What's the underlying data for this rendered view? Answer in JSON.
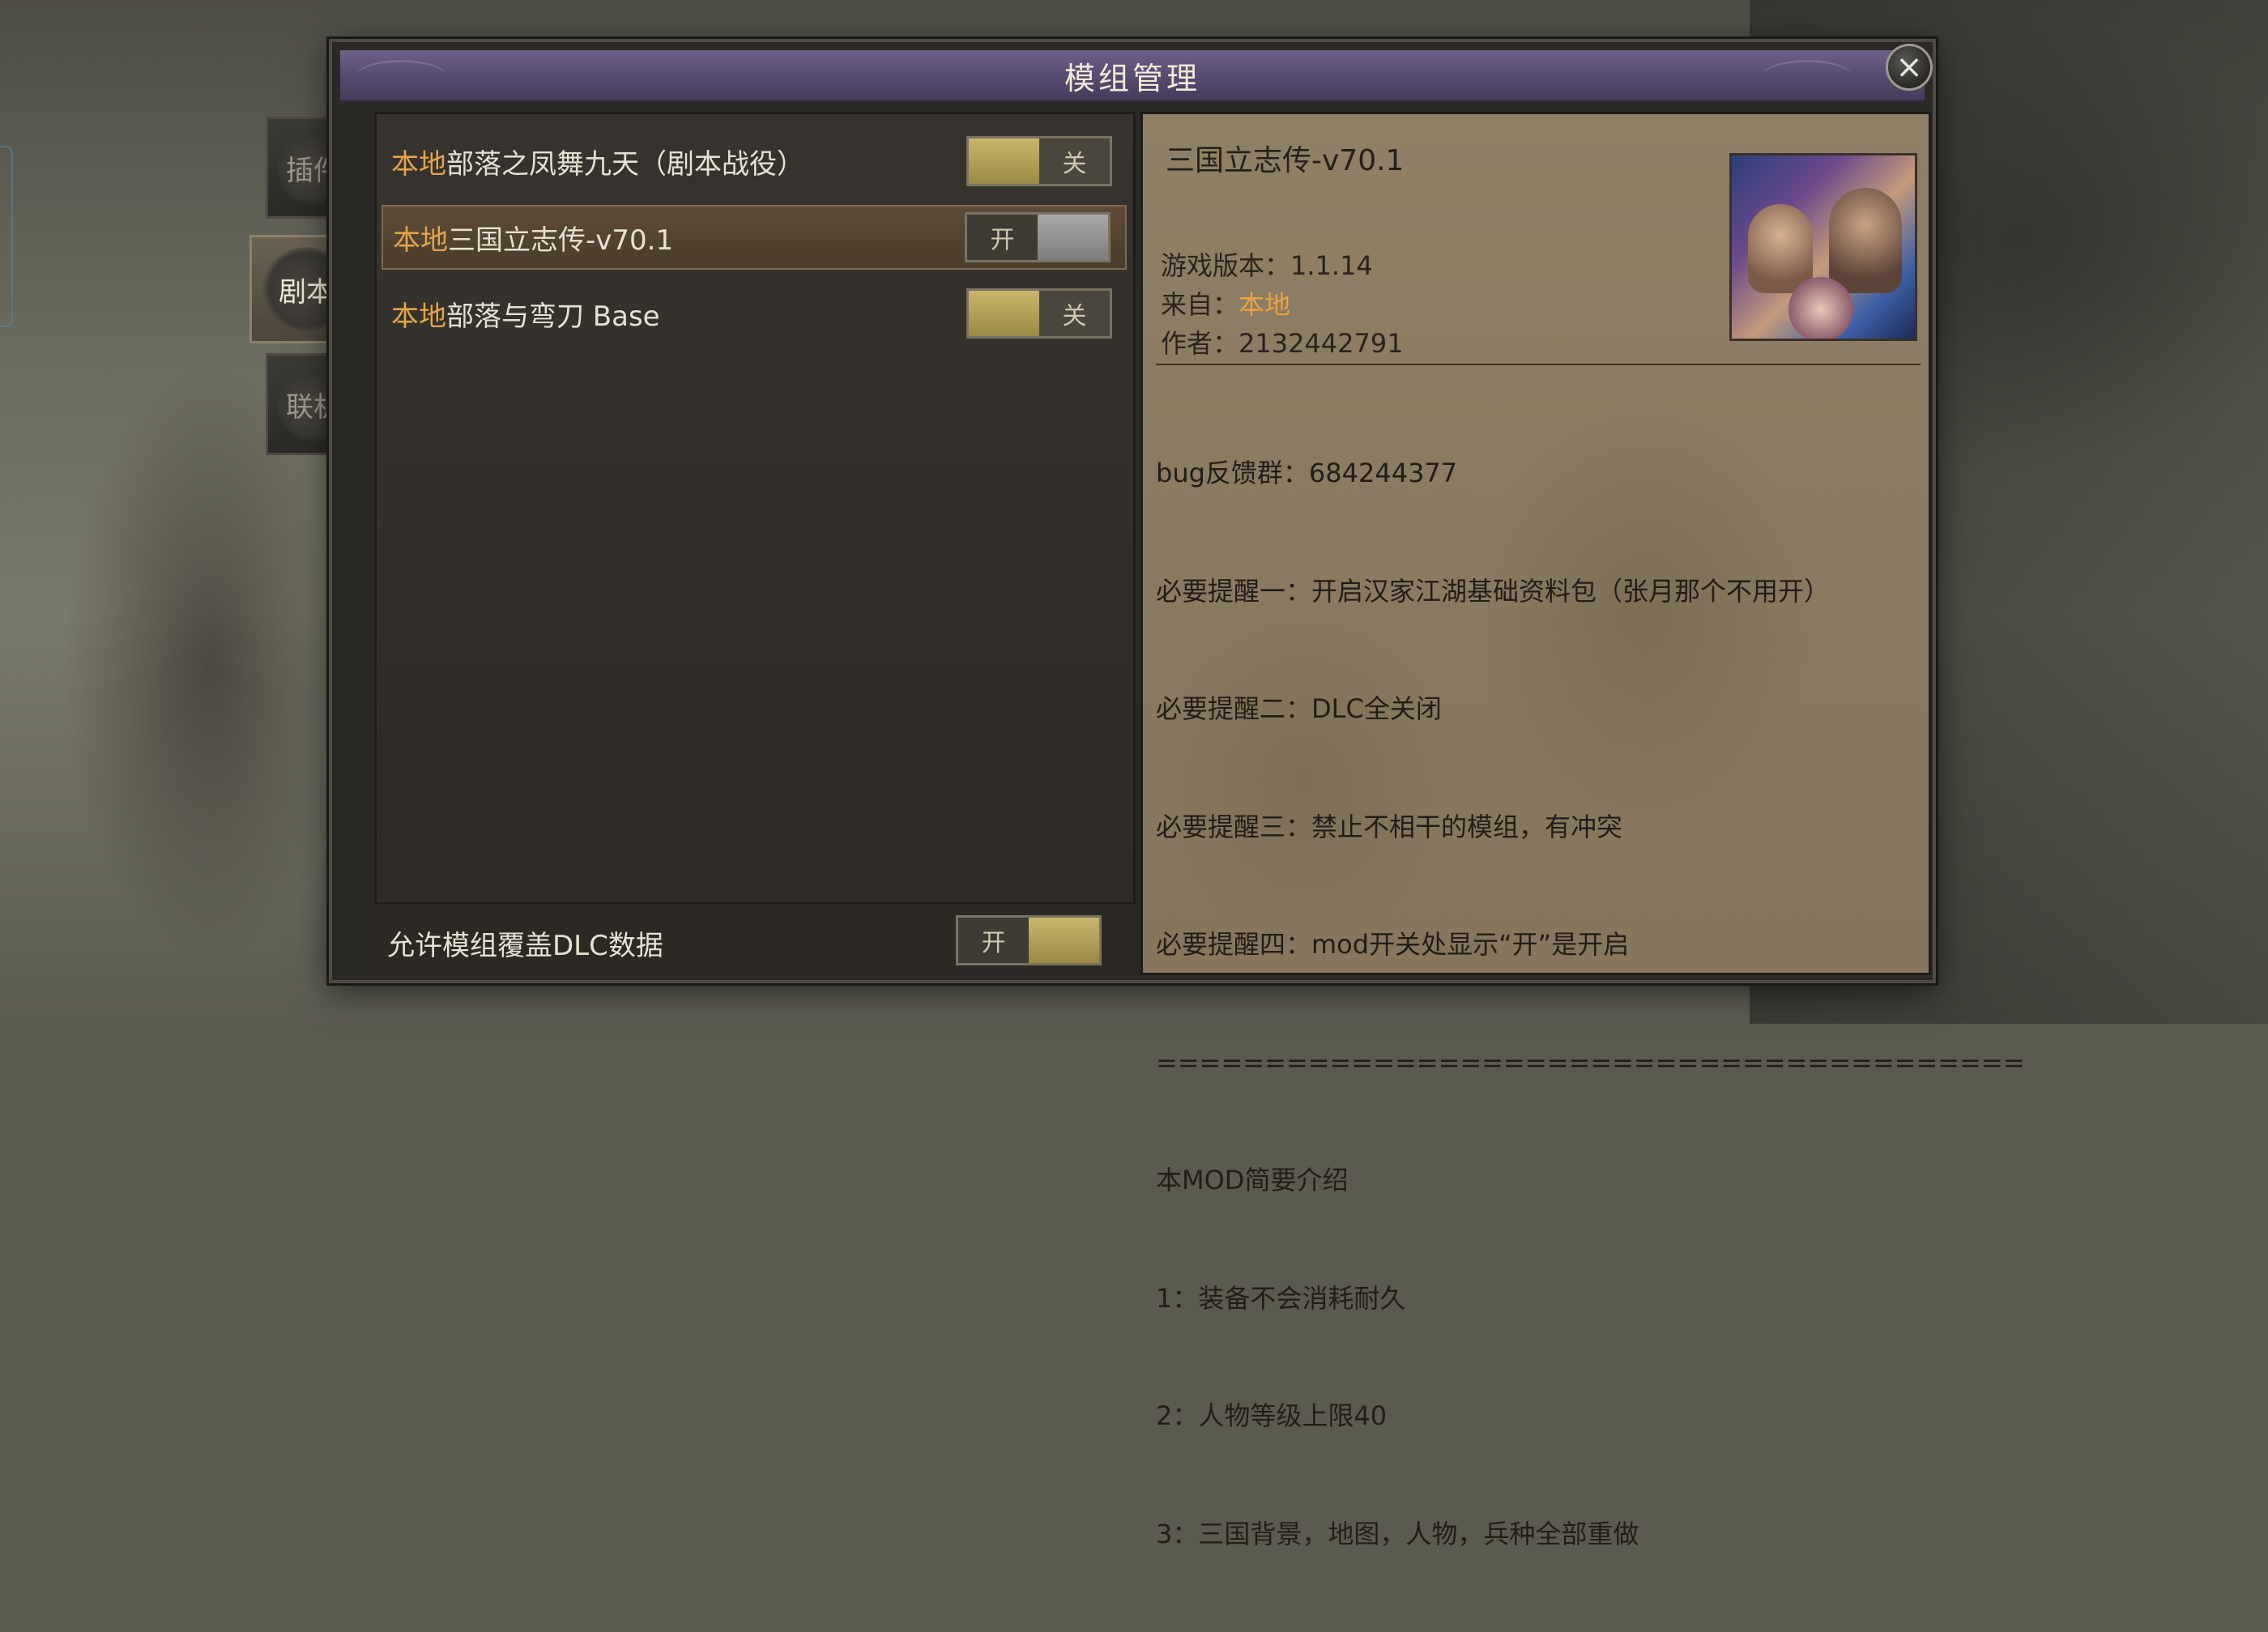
{
  "dialog": {
    "title": "模组管理"
  },
  "side_tabs": [
    {
      "label": "插件",
      "active": false
    },
    {
      "label": "剧本",
      "active": true
    },
    {
      "label": "联机",
      "active": false
    }
  ],
  "mods": [
    {
      "source": "本地",
      "name": "部落之凤舞九天（剧本战役）",
      "toggle_label": "关",
      "enabled": false,
      "selected": false
    },
    {
      "source": "本地",
      "name": "三国立志传-v70.1",
      "toggle_label": "开",
      "enabled": true,
      "selected": true
    },
    {
      "source": "本地",
      "name": "部落与弯刀 Base",
      "toggle_label": "关",
      "enabled": false,
      "selected": false
    }
  ],
  "dlc_override": {
    "label": "允许模组覆盖DLC数据",
    "toggle_label": "开",
    "enabled": true
  },
  "detail": {
    "title": "三国立志传-v70.1",
    "version_label": "游戏版本：",
    "version": "1.1.14",
    "from_label": "来自：",
    "from": "本地",
    "author_label": "作者：",
    "author": "2132442791",
    "description_lines": [
      "bug反馈群：684244377",
      "必要提醒一：开启汉家江湖基础资料包（张月那个不用开）",
      "必要提醒二：DLC全关闭",
      "必要提醒三：禁止不相干的模组，有冲突",
      "必要提醒四：mod开关处显示“开”是开启",
      "========================================",
      "本MOD简要介绍",
      "1：装备不会消耗耐久",
      "2：人物等级上限40",
      "3：三国背景，地图，人物，兵种全部重做"
    ]
  },
  "colors": {
    "source_accent": "#e2a54b",
    "title_bar": "#574a6f",
    "toggle_gold": "#c8b66c"
  }
}
